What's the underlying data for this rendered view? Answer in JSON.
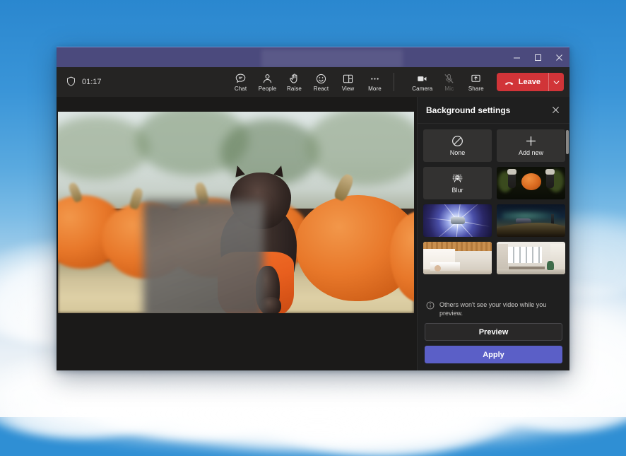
{
  "window": {
    "title_redacted": "",
    "controls": {
      "minimize": "minimize-button",
      "maximize": "maximize-button",
      "close": "close-button"
    }
  },
  "meeting_toolbar": {
    "shield_icon": "shield-icon",
    "timer": "01:17",
    "center_items": [
      {
        "icon": "chat-icon",
        "label": "Chat",
        "state": "enabled"
      },
      {
        "icon": "people-icon",
        "label": "People",
        "state": "enabled"
      },
      {
        "icon": "raise-hand-icon",
        "label": "Raise",
        "state": "enabled"
      },
      {
        "icon": "react-emoji-icon",
        "label": "React",
        "state": "enabled"
      },
      {
        "icon": "view-layout-icon",
        "label": "View",
        "state": "enabled"
      },
      {
        "icon": "more-ellipsis-icon",
        "label": "More",
        "state": "enabled"
      }
    ],
    "device_items": [
      {
        "icon": "camera-icon",
        "label": "Camera",
        "state": "enabled"
      },
      {
        "icon": "mic-muted-icon",
        "label": "Mic",
        "state": "muted"
      },
      {
        "icon": "share-screen-icon",
        "label": "Share",
        "state": "enabled"
      }
    ],
    "leave": {
      "label": "Leave",
      "icon": "hangup-icon",
      "caret": "chevron-down-icon",
      "color": "#d13438"
    }
  },
  "stage": {
    "video_tile_alt": "black cat in orange shirt sitting among pumpkins",
    "redaction_note": "blurred overlay"
  },
  "background_panel": {
    "title": "Background settings",
    "close_icon": "close-icon",
    "tiles": [
      {
        "type": "action",
        "icon": "none-slash-icon",
        "label": "None"
      },
      {
        "type": "action",
        "icon": "plus-icon",
        "label": "Add new"
      },
      {
        "type": "action",
        "icon": "blur-icon",
        "label": "Blur"
      },
      {
        "type": "image",
        "thumb": "pumpkin-hands-thumbnail",
        "label": ""
      },
      {
        "type": "image",
        "thumb": "space-warp-thumbnail",
        "label": ""
      },
      {
        "type": "image",
        "thumb": "scifi-landscape-thumbnail",
        "label": ""
      },
      {
        "type": "image",
        "thumb": "wood-ceiling-room-thumbnail",
        "label": ""
      },
      {
        "type": "image",
        "thumb": "office-windows-room-thumbnail",
        "label": ""
      }
    ],
    "note": {
      "icon": "info-icon",
      "text": "Others won't see your video while you preview."
    },
    "preview_button": "Preview",
    "apply_button": "Apply",
    "apply_color": "#5b5fc7"
  }
}
